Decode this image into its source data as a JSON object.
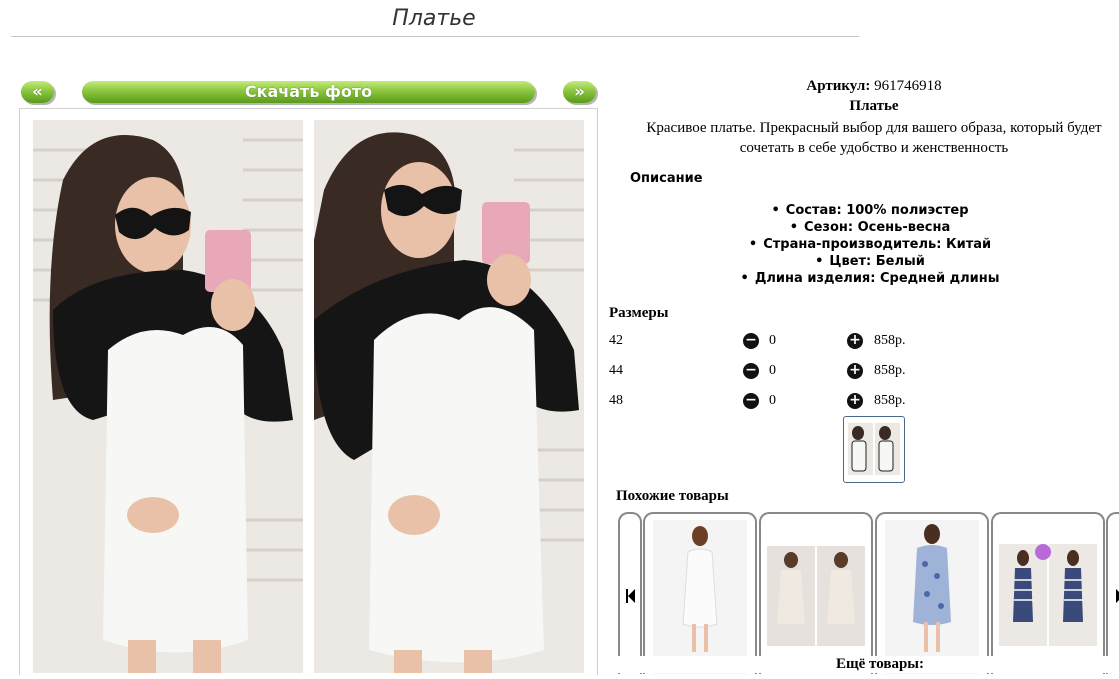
{
  "page": {
    "title": "Платье"
  },
  "gallery": {
    "prev_label": "«",
    "download_label": "Скачать фото",
    "next_label": "»"
  },
  "product": {
    "article_label": "Артикул:",
    "article_value": "961746918",
    "name": "Платье",
    "description": "Красивое платье. Прекрасный выбор для вашего образа, который будет сочетать в себе удобство и женственность"
  },
  "details": {
    "heading": "Описание",
    "specs": [
      "Состав: 100% полиэстер",
      "Сезон: Осень-весна",
      "Страна-производитель: Китай",
      "Цвет: Белый",
      "Длина изделия: Средней длины"
    ]
  },
  "sizes": {
    "heading": "Размеры",
    "minus_symbol": "−",
    "plus_symbol": "+",
    "rows": [
      {
        "size": "42",
        "qty": "0",
        "price": "858р."
      },
      {
        "size": "44",
        "qty": "0",
        "price": "858р."
      },
      {
        "size": "48",
        "qty": "0",
        "price": "858р."
      }
    ]
  },
  "similar": {
    "heading": "Похожие товары",
    "more_label": "Ещё товары:"
  },
  "colors": {
    "button_green": "#8cc63f",
    "dress_white": "#f7f7f5",
    "lace_black": "#151515"
  }
}
